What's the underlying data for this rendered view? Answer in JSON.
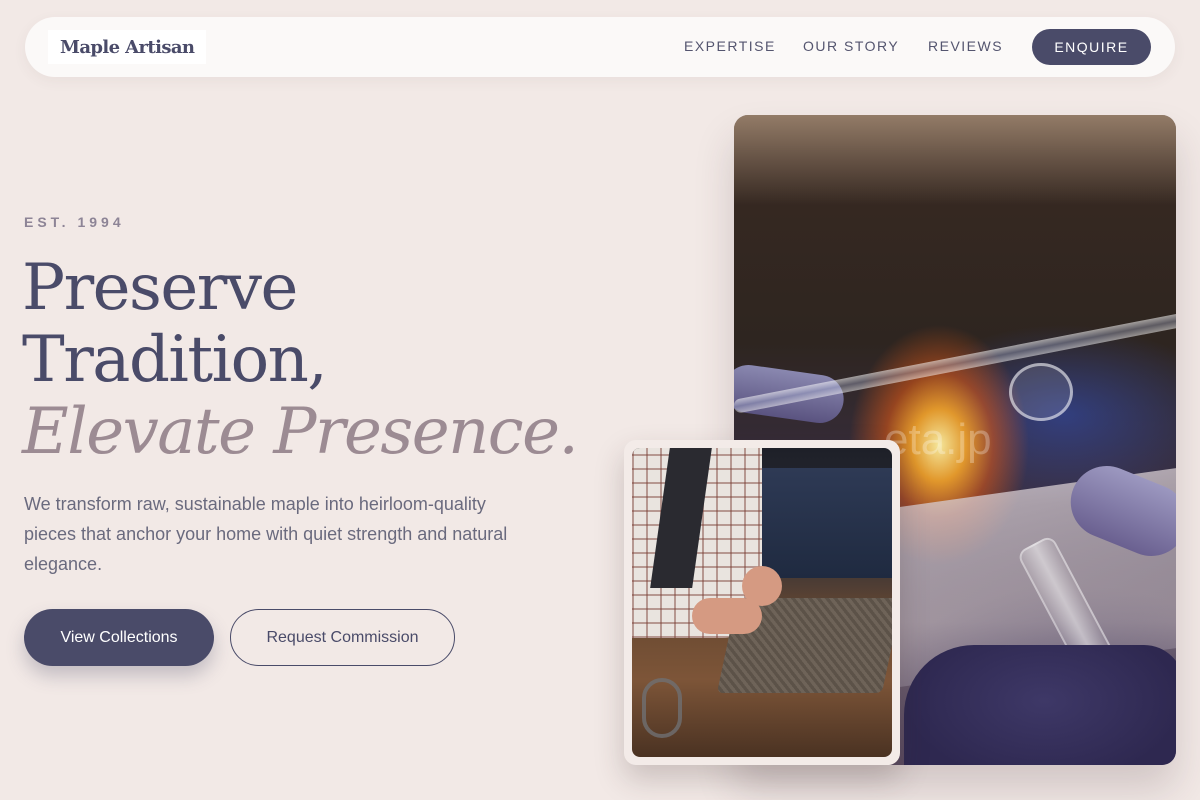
{
  "brand": {
    "name": "Maple Artisan"
  },
  "nav": {
    "links": [
      {
        "label": "EXPERTISE"
      },
      {
        "label": "OUR STORY"
      },
      {
        "label": "REVIEWS"
      }
    ],
    "cta_label": "ENQUIRE"
  },
  "hero": {
    "eyebrow": "EST. 1994",
    "headline": {
      "line1": "Preserve",
      "line2": "Tradition,",
      "line3": "Elevate Presence."
    },
    "lead": "We transform raw, sustainable maple into heirloom-quality pieces that anchor your home with quiet strength and natural elegance.",
    "primary_button": "View Collections",
    "secondary_button": "Request Commission"
  },
  "images": {
    "main_watermark": "eta.jp"
  },
  "colors": {
    "background": "#f2e9e6",
    "accent": "#4a4b69",
    "headline_italic": "#9c8b93",
    "nav_bg": "#fbf9f8"
  }
}
